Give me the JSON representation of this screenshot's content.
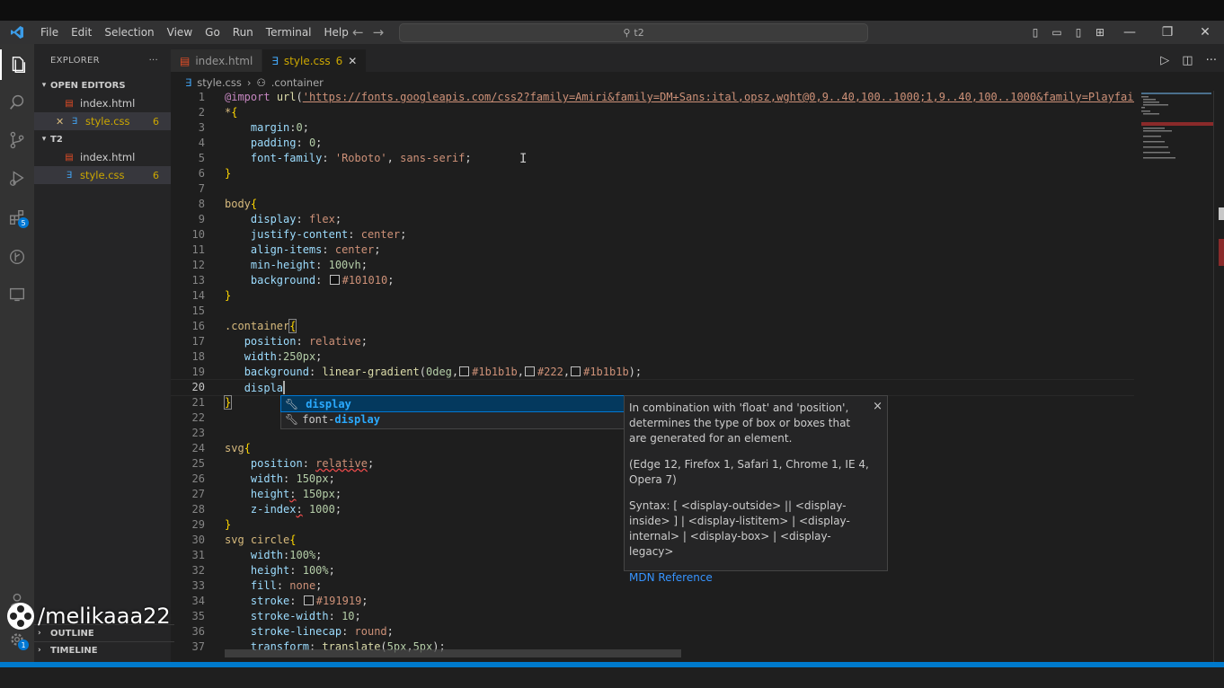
{
  "window": {
    "menu": [
      "File",
      "Edit",
      "Selection",
      "View",
      "Go",
      "Run",
      "Terminal",
      "Help"
    ],
    "search_text": "t2"
  },
  "explorer": {
    "title": "EXPLORER",
    "more": "···",
    "open_editors_label": "OPEN EDITORS",
    "open_editors": [
      {
        "name": "index.html",
        "type": "html"
      },
      {
        "name": "style.css",
        "type": "css",
        "problems": "6"
      }
    ],
    "folder_label": "T2",
    "files": [
      {
        "name": "index.html",
        "type": "html"
      },
      {
        "name": "style.css",
        "type": "css",
        "problems": "6"
      }
    ],
    "outline_label": "OUTLINE",
    "timeline_label": "TIMELINE"
  },
  "activity": {
    "extensions_badge": "5",
    "accounts_badge": "1"
  },
  "tabs": [
    {
      "name": "index.html"
    },
    {
      "name": "style.css",
      "problems": "6"
    }
  ],
  "breadcrumb": {
    "file": "style.css",
    "symbol": ".container"
  },
  "code": {
    "line_numbers": [
      "1",
      "2",
      "3",
      "4",
      "5",
      "6",
      "7",
      "8",
      "9",
      "10",
      "11",
      "12",
      "13",
      "14",
      "15",
      "16",
      "17",
      "18",
      "19",
      "20",
      "21",
      "22",
      "23",
      "24",
      "25",
      "26",
      "27",
      "28",
      "29",
      "30",
      "31",
      "32",
      "33",
      "34",
      "35",
      "36",
      "37"
    ],
    "import_url": "'https://fonts.googleapis.com/css2?family=Amiri&family=DM+Sans:ital,opsz,wght@0,9..40,100..1000;1,9..40,100..1000&family=Playfair+Displa",
    "typed": "displa"
  },
  "suggest": {
    "items": [
      {
        "pre": "",
        "match": "display",
        "post": ""
      },
      {
        "pre": "font-",
        "match": "display",
        "post": ""
      }
    ]
  },
  "docs": {
    "description": "In combination with 'float' and 'position', determines the type of box or boxes that are generated for an element.",
    "browsers": "(Edge 12, Firefox 1, Safari 1, Chrome 1, IE 4, Opera 7)",
    "syntax": "Syntax: [ <display-outside> || <display-inside> ] | <display-listitem> | <display-internal> | <display-box> | <display-legacy>",
    "link": "MDN Reference",
    "close": "×"
  },
  "watermark": "/melikaaa22",
  "colors": {
    "accent": "#007acc",
    "editor_bg": "#1e1e1e",
    "sidebar_bg": "#252526",
    "activity_bg": "#333333"
  }
}
